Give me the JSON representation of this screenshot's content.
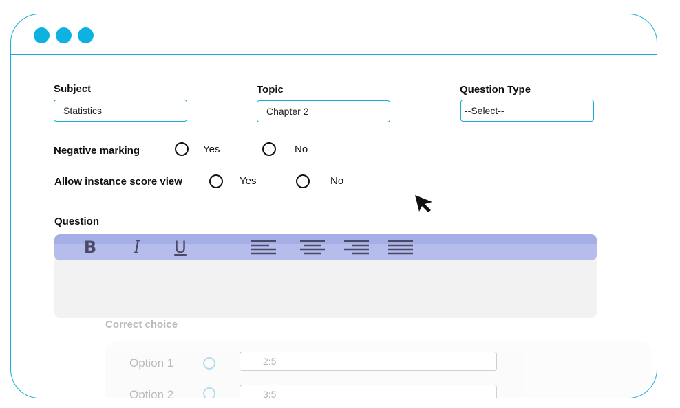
{
  "window": {
    "dots": [
      "close",
      "minimize",
      "maximize"
    ],
    "accent_color": "#1aaed6"
  },
  "form": {
    "subject": {
      "label": "Subject",
      "value": "Statistics"
    },
    "topic": {
      "label": "Topic",
      "value": "Chapter 2"
    },
    "question_type": {
      "label": "Question Type",
      "value": "--Select--"
    },
    "negative_marking": {
      "label": "Negative marking",
      "yes": "Yes",
      "no": "No"
    },
    "allow_score_view": {
      "label": "Allow instance score view",
      "yes": "Yes",
      "no": "No"
    },
    "question": {
      "label": "Question",
      "toolbar": {
        "bold": "B",
        "italic": "I",
        "underline": "U",
        "icons": [
          "bold-icon",
          "italic-icon",
          "underline-icon",
          "align-left-icon",
          "align-center-icon",
          "align-right-icon",
          "align-justify-icon"
        ],
        "color": "#b6bceb"
      }
    },
    "correct_choice": {
      "label": "Correct choice",
      "options": [
        {
          "label": "Option 1",
          "value": "2:5"
        },
        {
          "label": "Option 2",
          "value": "3:5"
        }
      ]
    }
  }
}
